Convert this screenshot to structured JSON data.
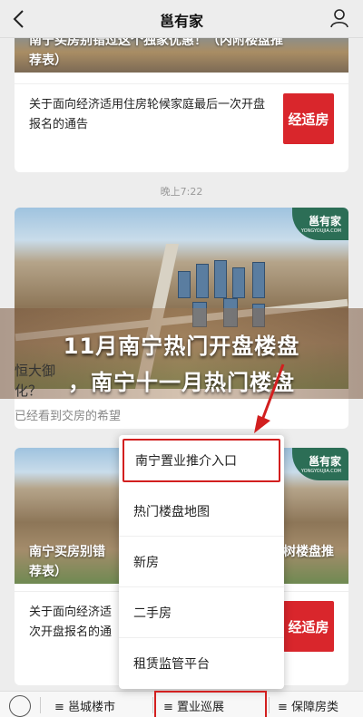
{
  "header": {
    "title": "邕有家"
  },
  "top_card": {
    "overlay_partial": "南宁买房别错过这个独家优惠！（内附楼盘推",
    "overlay_line2": "荐表）",
    "article_text": "关于面向经济适用住房轮候家庭最后一次开盘报名的通告",
    "thumb_label": "经适房"
  },
  "timestamp": "晚上7:22",
  "main_card": {
    "logo": "邕有家",
    "logo_sub": "YONGYOUJIA.COM",
    "line1_partial": "恒大御",
    "line2_partial": "化？",
    "read_status": "已经看到交房的希望"
  },
  "banner": {
    "line1": "11月南宁热门开盘楼盘",
    "line2": "，南宁十一月热门楼盘"
  },
  "bottom_card": {
    "logo": "邕有家",
    "logo_sub": "YONGYOUJIA.COM",
    "overlay_left": "南宁买房别错",
    "overlay_right": "树楼盘推",
    "overlay_line2": "荐表）",
    "article_left": "关于面向经济适",
    "article_left2": "次开盘报名的通",
    "thumb_label": "经适房"
  },
  "menu": {
    "items": [
      "南宁置业推介入口",
      "热门楼盘地图",
      "新房",
      "二手房",
      "租赁监管平台"
    ]
  },
  "tabbar": {
    "tabs": [
      "≡ 邕城楼市",
      "≡ 置业巡展",
      "≡ 保障房类"
    ]
  },
  "colors": {
    "accent_red": "#d21f1f",
    "thumb_red": "#d9262c",
    "logo_green": "#2c6e56"
  }
}
